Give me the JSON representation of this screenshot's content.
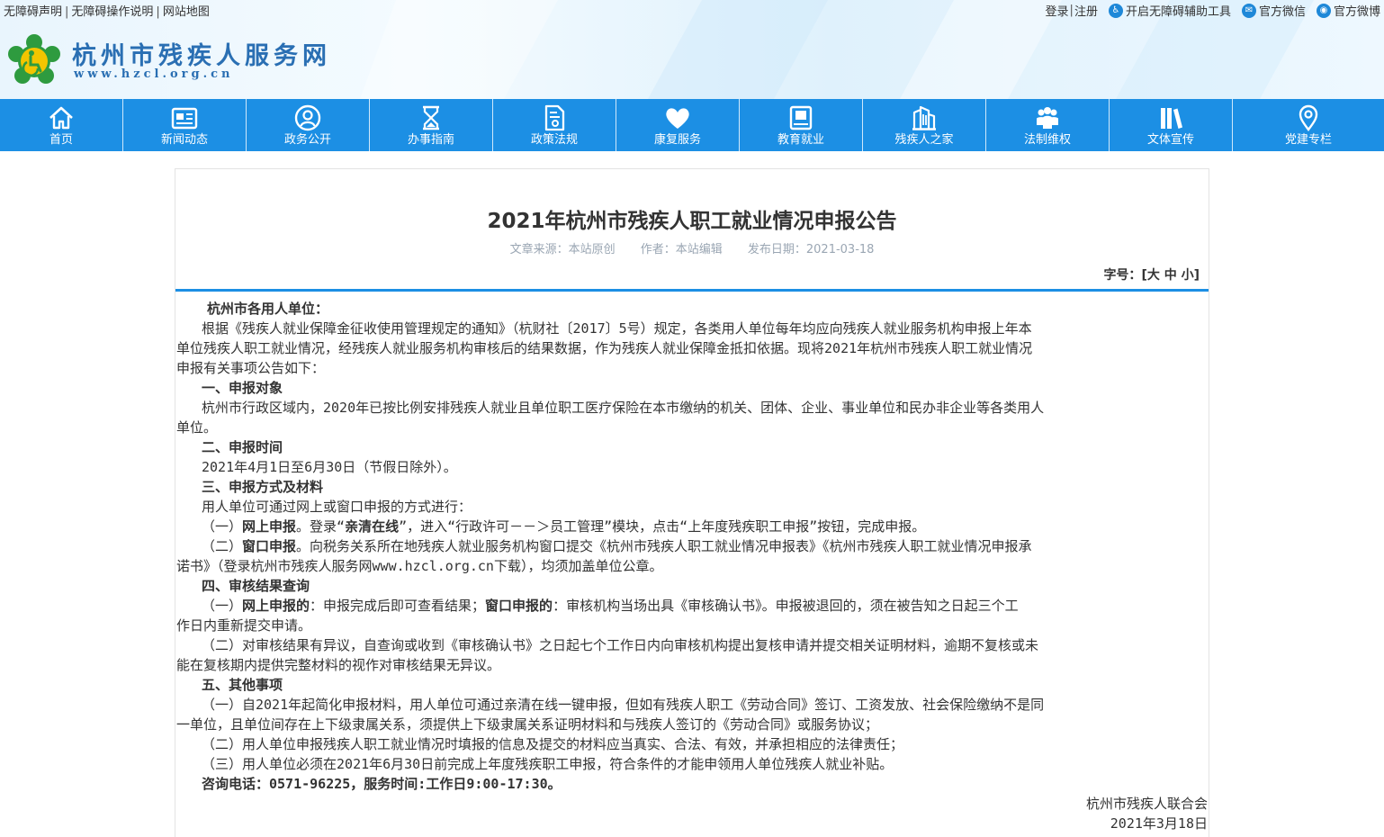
{
  "header": {
    "top_left_links": [
      "无障碍声明",
      "无障碍操作说明",
      "网站地图"
    ],
    "login": "登录",
    "register": "注册",
    "accessibility_tool": "开启无障碍辅助工具",
    "wechat": "官方微信",
    "weibo": "官方微博",
    "site_name": "杭州市残疾人服务网",
    "site_url": "www.hzcl.org.cn"
  },
  "nav": {
    "items": [
      {
        "label": "首页",
        "icon": "home-icon"
      },
      {
        "label": "新闻动态",
        "icon": "news-icon"
      },
      {
        "label": "政务公开",
        "icon": "user-circle-icon"
      },
      {
        "label": "办事指南",
        "icon": "hourglass-icon"
      },
      {
        "label": "政策法规",
        "icon": "document-icon"
      },
      {
        "label": "康复服务",
        "icon": "heart-icon"
      },
      {
        "label": "教育就业",
        "icon": "book-icon"
      },
      {
        "label": "残疾人之家",
        "icon": "building-icon"
      },
      {
        "label": "法制维权",
        "icon": "people-icon"
      },
      {
        "label": "文体宣传",
        "icon": "books-icon"
      },
      {
        "label": "党建专栏",
        "icon": "location-pin-icon"
      }
    ]
  },
  "article": {
    "title": "2021年杭州市残疾人职工就业情况申报公告",
    "source": "文章来源：本站原创",
    "author": "作者：本站编辑",
    "date": "发布日期：2021-03-18",
    "font_size_label": "字号：",
    "font_size_options": [
      "大",
      "中",
      "小"
    ],
    "body": {
      "greeting": "杭州市各用人单位：",
      "intro_1": "根据《残疾人就业保障金征收使用管理规定的通知》（杭财社〔2017〕5号）规定，各类用人单位每年均应向残疾人就业服务机构申报上年本",
      "intro_2": "单位残疾人职工就业情况，经残疾人就业服务机构审核后的结果数据，作为残疾人就业保障金抵扣依据。现将2021年杭州市残疾人职工就业情况",
      "intro_3": "申报有关事项公告如下：",
      "s1_head": "一、申报对象",
      "s1_1": "杭州市行政区域内，2020年已按比例安排残疾人就业且单位职工医疗保险在本市缴纳的机关、团体、企业、事业单位和民办非企业等各类用人",
      "s1_2": "单位。",
      "s2_head": "二、申报时间",
      "s2_1": "2021年4月1日至6月30日（节假日除外）。",
      "s3_head": "三、申报方式及材料",
      "s3_1": "用人单位可通过网上或窗口申报的方式进行：",
      "s3_2a": "（一）",
      "s3_2b": "网上申报",
      "s3_2c": "。登录“",
      "s3_2d": "亲清在线",
      "s3_2e": "”，进入“行政许可－－＞员工管理”模块，点击“上年度残疾职工申报”按钮，完成申报。",
      "s3_3a": "（二）",
      "s3_3b": "窗口申报",
      "s3_3c": "。向税务关系所在地残疾人就业服务机构窗口提交《杭州市残疾人职工就业情况申报表》《杭州市残疾人职工就业情况申报承",
      "s3_4": "诺书》（登录杭州市残疾人服务网www.hzcl.org.cn下载），均须加盖单位公章。",
      "s4_head": "四、审核结果查询",
      "s4_1a": "（一）",
      "s4_1b": "网上申报的",
      "s4_1c": "：申报完成后即可查看结果；",
      "s4_1d": "窗口申报的",
      "s4_1e": "：审核机构当场出具《审核确认书》。申报被退回的，须在被告知之日起三个工",
      "s4_2": "作日内重新提交申请。",
      "s4_3": "（二）对审核结果有异议，自查询或收到《审核确认书》之日起七个工作日内向审核机构提出复核申请并提交相关证明材料，逾期不复核或未",
      "s4_4": "能在复核期内提供完整材料的视作对审核结果无异议。",
      "s5_head": "五、其他事项",
      "s5_1": "（一）自2021年起简化申报材料，用人单位可通过亲清在线一键申报，但如有残疾人职工《劳动合同》签订、工资发放、社会保险缴纳不是同",
      "s5_2": "一单位，且单位间存在上下级隶属关系，须提供上下级隶属关系证明材料和与残疾人签订的《劳动合同》或服务协议；",
      "s5_3": "（二）用人单位申报残疾人职工就业情况时填报的信息及提交的材料应当真实、合法、有效，并承担相应的法律责任；",
      "s5_4": "（三）用人单位必须在2021年6月30日前完成上年度残疾职工申报，符合条件的才能申领用人单位残疾人就业补贴。",
      "contact": "咨询电话：0571-96225，服务时间:工作日9:00-17:30。",
      "signature": "杭州市残疾人联合会",
      "sign_date": "2021年3月18日"
    }
  },
  "colors": {
    "nav_bg": "#1c8fe4",
    "title_blue": "#2a6fb3",
    "logo_green": "#2e9b3f",
    "logo_yellow": "#f2c500"
  }
}
